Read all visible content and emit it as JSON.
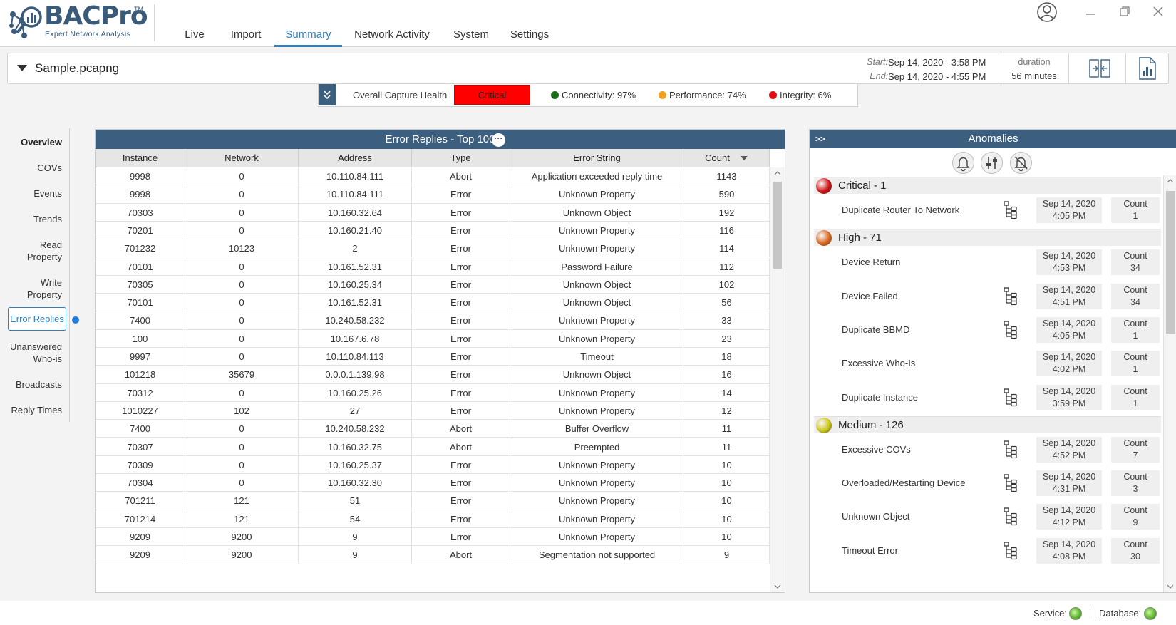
{
  "app": {
    "logo_text": "BACPro",
    "logo_tm": "TM",
    "logo_subtitle": "Expert Network Analysis"
  },
  "nav": {
    "tabs": [
      "Live",
      "Import",
      "Summary",
      "Network Activity",
      "System",
      "Settings"
    ],
    "active": "Summary"
  },
  "file": {
    "name": "Sample.pcapng",
    "start_label": "Start:",
    "start_value": "Sep 14, 2020 - 3:58 PM",
    "end_label": "End:",
    "end_value": "Sep 14, 2020 - 4:55 PM",
    "duration_label": "duration",
    "duration_value": "56 minutes"
  },
  "health": {
    "label": "Overall Capture Health",
    "status": "Critical",
    "connectivity": "Connectivity: 97%",
    "performance": "Performance: 74%",
    "integrity": "Integrity: 6%",
    "colors": {
      "critical": "#ff0000",
      "connectivity": "#1a6b1a",
      "performance": "#f0a020",
      "integrity": "#e01010"
    }
  },
  "sidebar": {
    "items": [
      {
        "label": "Overview"
      },
      {
        "label": "COVs"
      },
      {
        "label": "Events"
      },
      {
        "label": "Trends"
      },
      {
        "label": "Read\nProperty"
      },
      {
        "label": "Write\nProperty"
      },
      {
        "label": "Error Replies"
      },
      {
        "label": "Unanswered\nWho-is"
      },
      {
        "label": "Broadcasts"
      },
      {
        "label": "Reply Times"
      }
    ],
    "active": "Error Replies"
  },
  "table": {
    "title": "Error Replies - Top 100",
    "columns": [
      "Instance",
      "Network",
      "Address",
      "Type",
      "Error String",
      "Count"
    ],
    "rows": [
      [
        "9998",
        "0",
        "10.110.84.111",
        "Abort",
        "Application exceeded reply time",
        "1143"
      ],
      [
        "9998",
        "0",
        "10.110.84.111",
        "Error",
        "Unknown Property",
        "590"
      ],
      [
        "70303",
        "0",
        "10.160.32.64",
        "Error",
        "Unknown Object",
        "192"
      ],
      [
        "70201",
        "0",
        "10.160.21.40",
        "Error",
        "Unknown Property",
        "116"
      ],
      [
        "701232",
        "10123",
        "2",
        "Error",
        "Unknown Property",
        "114"
      ],
      [
        "70101",
        "0",
        "10.161.52.31",
        "Error",
        "Password Failure",
        "112"
      ],
      [
        "70305",
        "0",
        "10.160.25.34",
        "Error",
        "Unknown Object",
        "102"
      ],
      [
        "70101",
        "0",
        "10.161.52.31",
        "Error",
        "Unknown Object",
        "56"
      ],
      [
        "7400",
        "0",
        "10.240.58.232",
        "Error",
        "Unknown Property",
        "33"
      ],
      [
        "100",
        "0",
        "10.167.6.78",
        "Error",
        "Unknown Property",
        "23"
      ],
      [
        "9997",
        "0",
        "10.110.84.113",
        "Error",
        "Timeout",
        "18"
      ],
      [
        "101218",
        "35679",
        "0.0.0.1.139.98",
        "Error",
        "Unknown Object",
        "16"
      ],
      [
        "70312",
        "0",
        "10.160.25.26",
        "Error",
        "Unknown Property",
        "14"
      ],
      [
        "1010227",
        "102",
        "27",
        "Error",
        "Unknown Property",
        "12"
      ],
      [
        "7400",
        "0",
        "10.240.58.232",
        "Abort",
        "Buffer Overflow",
        "11"
      ],
      [
        "70307",
        "0",
        "10.160.32.75",
        "Abort",
        "Preempted",
        "11"
      ],
      [
        "70309",
        "0",
        "10.160.25.37",
        "Error",
        "Unknown Property",
        "10"
      ],
      [
        "70304",
        "0",
        "10.160.32.30",
        "Error",
        "Unknown Property",
        "10"
      ],
      [
        "701211",
        "121",
        "51",
        "Error",
        "Unknown Property",
        "10"
      ],
      [
        "701214",
        "121",
        "54",
        "Error",
        "Unknown Property",
        "10"
      ],
      [
        "9209",
        "9200",
        "9",
        "Error",
        "Unknown Property",
        "10"
      ],
      [
        "9209",
        "9200",
        "9",
        "Abort",
        "Segmentation not supported",
        "9"
      ]
    ]
  },
  "anomalies": {
    "title": "Anomalies",
    "expand_glyph": ">>",
    "count_label": "Count",
    "groups": [
      {
        "title": "Critical - 1",
        "color": "#cc1010",
        "items": [
          {
            "name": "Duplicate Router To Network",
            "tree": true,
            "date": "Sep 14, 2020",
            "time": "4:05 PM",
            "count": "1"
          }
        ]
      },
      {
        "title": "High - 71",
        "color": "#d9641a",
        "items": [
          {
            "name": "Device Return",
            "tree": false,
            "date": "Sep 14, 2020",
            "time": "4:53 PM",
            "count": "34"
          },
          {
            "name": "Device Failed",
            "tree": true,
            "date": "Sep 14, 2020",
            "time": "4:51 PM",
            "count": "34"
          },
          {
            "name": "Duplicate BBMD",
            "tree": true,
            "date": "Sep 14, 2020",
            "time": "4:05 PM",
            "count": "1"
          },
          {
            "name": "Excessive Who-Is",
            "tree": false,
            "date": "Sep 14, 2020",
            "time": "4:02 PM",
            "count": "1"
          },
          {
            "name": "Duplicate Instance",
            "tree": true,
            "date": "Sep 14, 2020",
            "time": "3:59 PM",
            "count": "1"
          }
        ]
      },
      {
        "title": "Medium - 126",
        "color": "#c9c416",
        "items": [
          {
            "name": "Excessive COVs",
            "tree": true,
            "date": "Sep 14, 2020",
            "time": "4:52 PM",
            "count": "7"
          },
          {
            "name": "Overloaded/Restarting Device",
            "tree": true,
            "date": "Sep 14, 2020",
            "time": "4:31 PM",
            "count": "3"
          },
          {
            "name": "Unknown Object",
            "tree": true,
            "date": "Sep 14, 2020",
            "time": "4:12 PM",
            "count": "9"
          },
          {
            "name": "Timeout Error",
            "tree": true,
            "date": "Sep 14, 2020",
            "time": "4:08 PM",
            "count": "30"
          }
        ]
      }
    ]
  },
  "status": {
    "service_label": "Service:",
    "database_label": "Database:"
  },
  "icons": [
    "user-icon",
    "minimize-icon",
    "restore-icon",
    "close-icon",
    "compare-icon",
    "report-icon",
    "collapse-icon",
    "more-icon",
    "bell-icon",
    "filter-icon",
    "bell-off-icon",
    "tree-icon",
    "sort-down-icon"
  ]
}
